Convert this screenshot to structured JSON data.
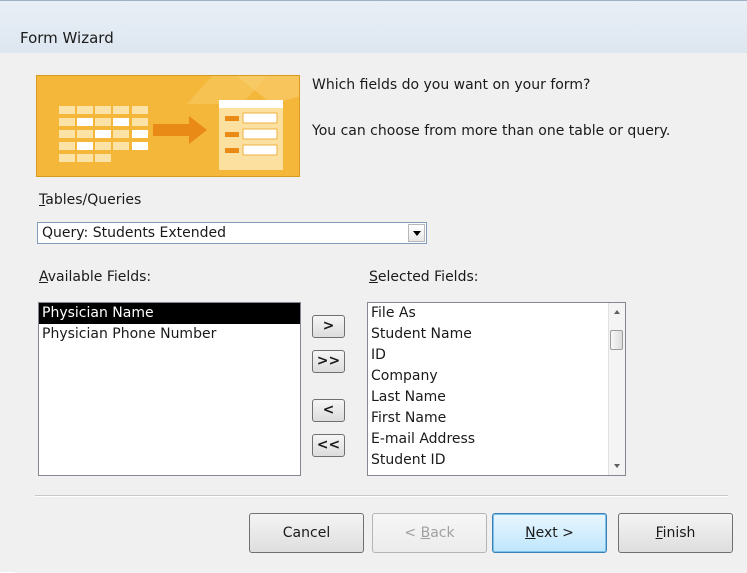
{
  "window": {
    "title": "Form Wizard"
  },
  "prompt": {
    "line1": "Which fields do you want on your form?",
    "line2": "You can choose from more than one table or query."
  },
  "tables_queries": {
    "label_mnemonic": "T",
    "label_rest": "ables/Queries",
    "selected_value": "Query: Students Extended"
  },
  "available_fields": {
    "label_mnemonic": "A",
    "label_rest": "vailable Fields:",
    "items": [
      "Physician Name",
      "Physician Phone Number"
    ],
    "selected_index": 0
  },
  "selected_fields": {
    "label_mnemonic": "S",
    "label_rest": "elected Fields:",
    "items": [
      "File As",
      "Student Name",
      "ID",
      "Company",
      "Last Name",
      "First Name",
      "E-mail Address",
      "Student ID"
    ]
  },
  "move_buttons": {
    "add_one": ">",
    "add_all": ">>",
    "remove_one": "<",
    "remove_all": "<<"
  },
  "footer": {
    "cancel": "Cancel",
    "back_prefix": "< ",
    "back_mnemonic": "B",
    "back_rest": "ack",
    "next_mnemonic": "N",
    "next_rest": "ext >",
    "finish_mnemonic": "F",
    "finish_rest": "inish"
  },
  "colors": {
    "illustration": "#f5b73a",
    "selection": "#000000"
  }
}
